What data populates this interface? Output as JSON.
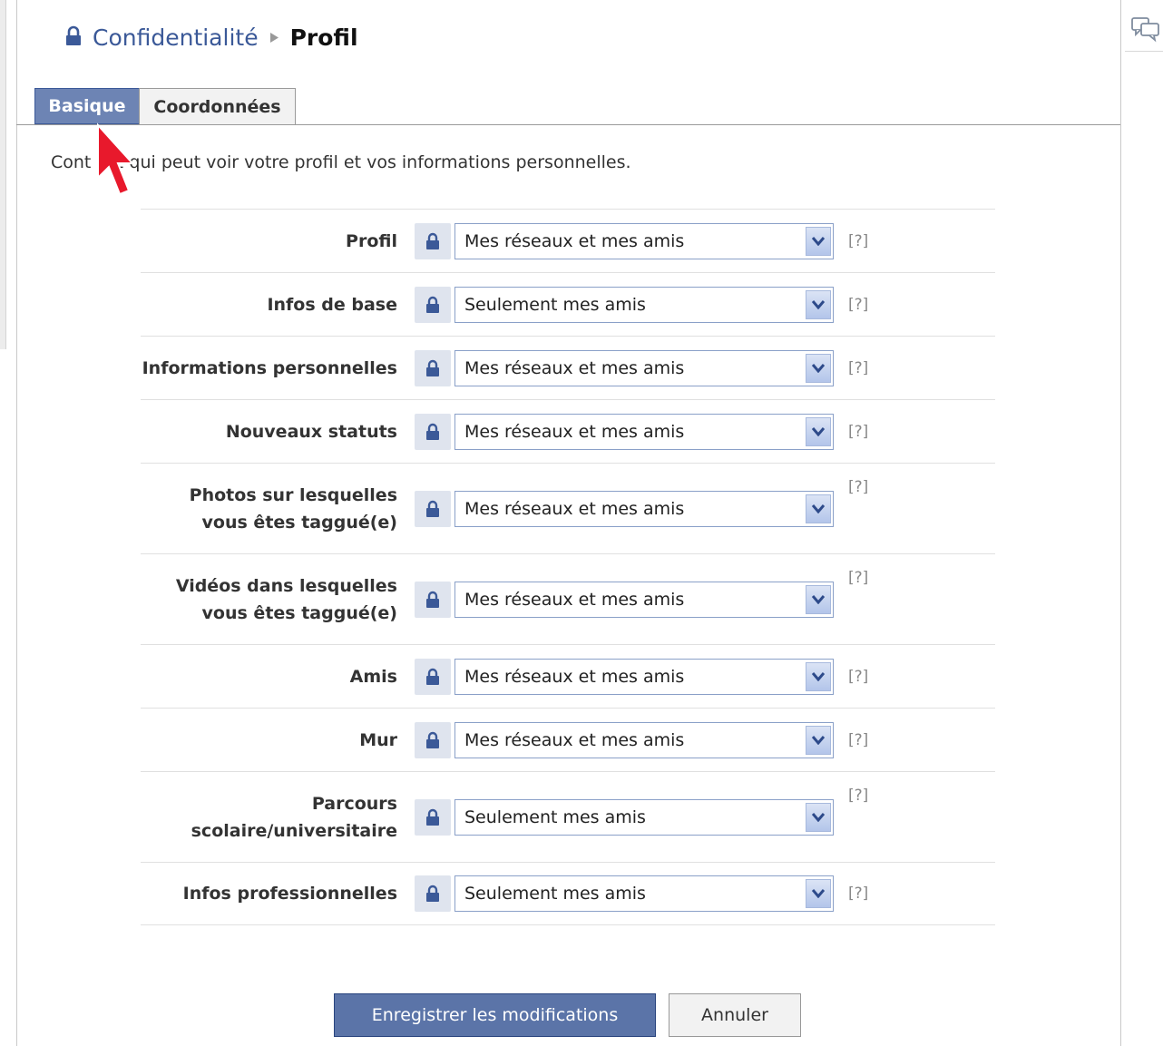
{
  "breadcrumb": {
    "parent": "Confidentialité",
    "current": "Profil"
  },
  "tabs": [
    {
      "label": "Basique",
      "active": true
    },
    {
      "label": "Coordonnées",
      "active": false
    }
  ],
  "intro_text_left": "Cont",
  "intro_text_right": "z qui peut voir votre profil et vos informations personnelles.",
  "settings": [
    {
      "label_lines": [
        "Profil"
      ],
      "value": "Mes réseaux et mes amis",
      "help": "[?]"
    },
    {
      "label_lines": [
        "Infos de base"
      ],
      "value": "Seulement mes amis",
      "help": "[?]"
    },
    {
      "label_lines": [
        "Informations personnelles"
      ],
      "value": "Mes réseaux et mes amis",
      "help": "[?]"
    },
    {
      "label_lines": [
        "Nouveaux statuts"
      ],
      "value": "Mes réseaux et mes amis",
      "help": "[?]"
    },
    {
      "label_lines": [
        "Photos sur lesquelles",
        "vous êtes taggué(e)"
      ],
      "value": "Mes réseaux et mes amis",
      "help": "[?]"
    },
    {
      "label_lines": [
        "Vidéos dans lesquelles",
        "vous êtes taggué(e)"
      ],
      "value": "Mes réseaux et mes amis",
      "help": "[?]"
    },
    {
      "label_lines": [
        "Amis"
      ],
      "value": "Mes réseaux et mes amis",
      "help": "[?]"
    },
    {
      "label_lines": [
        "Mur"
      ],
      "value": "Mes réseaux et mes amis",
      "help": "[?]"
    },
    {
      "label_lines": [
        "Parcours",
        "scolaire/universitaire"
      ],
      "value": "Seulement mes amis",
      "help": "[?]"
    },
    {
      "label_lines": [
        "Infos professionnelles"
      ],
      "value": "Seulement mes amis",
      "help": "[?]"
    }
  ],
  "buttons": {
    "save": "Enregistrer les modifications",
    "cancel": "Annuler"
  },
  "colors": {
    "link": "#3b5998",
    "tab_active_bg": "#6d84b4",
    "save_button_bg": "#5b74a8",
    "cursor": "#e8192c"
  }
}
